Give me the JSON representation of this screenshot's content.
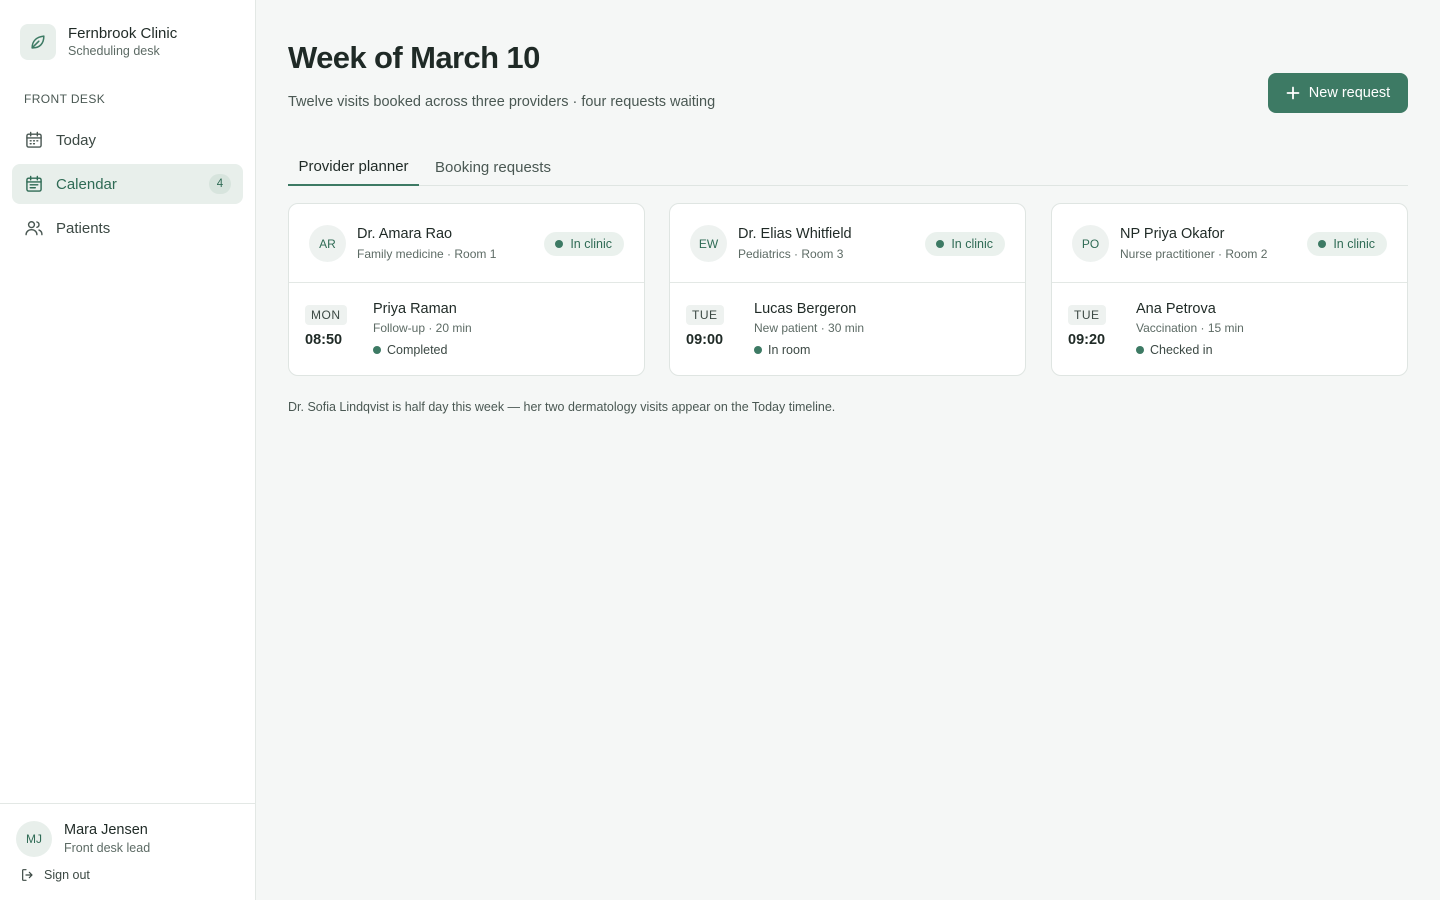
{
  "brand": {
    "name": "Fernbrook Clinic",
    "subtitle": "Scheduling desk",
    "icon": "leaf-icon"
  },
  "sidebar": {
    "section_label": "FRONT DESK",
    "items": [
      {
        "label": "Today",
        "icon": "calendar-icon",
        "active": false
      },
      {
        "label": "Calendar",
        "icon": "calendar-grid-icon",
        "active": true,
        "badge": "4"
      },
      {
        "label": "Patients",
        "icon": "users-icon",
        "active": false
      }
    ]
  },
  "user": {
    "initials": "MJ",
    "name": "Mara Jensen",
    "role": "Front desk lead",
    "sign_out": "Sign out"
  },
  "header": {
    "title": "Week of March 10",
    "subtitle": "Twelve visits booked across three providers · four requests waiting",
    "new_request_label": "New request"
  },
  "tabs": [
    {
      "label": "Provider planner",
      "active": true
    },
    {
      "label": "Booking requests",
      "active": false
    }
  ],
  "providers": [
    {
      "initials": "AR",
      "name": "Dr. Amara Rao",
      "role": "Family medicine · Room 1",
      "status": "In clinic",
      "appointment": {
        "day": "MON",
        "time": "08:50",
        "patient": "Priya Raman",
        "visit": "Follow-up · 20 min",
        "status": "Completed"
      }
    },
    {
      "initials": "EW",
      "name": "Dr. Elias Whitfield",
      "role": "Pediatrics · Room 3",
      "status": "In clinic",
      "appointment": {
        "day": "TUE",
        "time": "09:00",
        "patient": "Lucas Bergeron",
        "visit": "New patient · 30 min",
        "status": "In room"
      }
    },
    {
      "initials": "PO",
      "name": "NP Priya Okafor",
      "role": "Nurse practitioner · Room 2",
      "status": "In clinic",
      "appointment": {
        "day": "TUE",
        "time": "09:20",
        "patient": "Ana Petrova",
        "visit": "Vaccination · 15 min",
        "status": "Checked in"
      }
    }
  ],
  "footnote": "Dr. Sofia Lindqvist is half day this week — her two dermatology visits appear on the Today timeline.",
  "colors": {
    "accent": "#3d7a64",
    "accent_soft": "#e8efeb",
    "background": "#f5f7f6"
  }
}
